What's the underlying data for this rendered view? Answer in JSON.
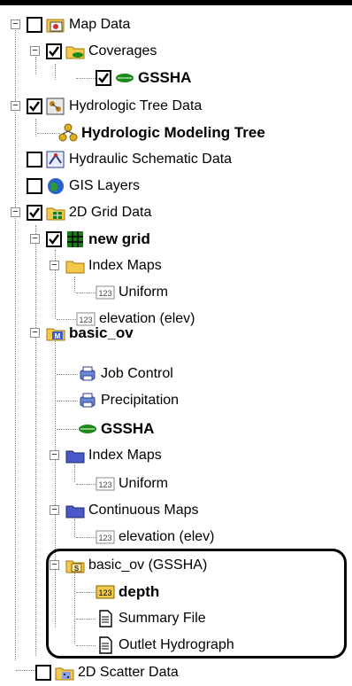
{
  "tree": {
    "map_data": "Map Data",
    "coverages": "Coverages",
    "gssha_cov": "GSSHA",
    "hydrologic_tree_data": "Hydrologic Tree Data",
    "hydrologic_modeling_tree": "Hydrologic Modeling Tree",
    "hydraulic_schematic_data": "Hydraulic Schematic Data",
    "gis_layers": "GIS Layers",
    "grid_data_2d": "2D Grid Data",
    "new_grid": "new grid",
    "index_maps_1": "Index Maps",
    "uniform_1": "Uniform",
    "elevation_1": "elevation (elev)",
    "basic_ov": "basic_ov",
    "job_control": "Job Control",
    "precipitation": "Precipitation",
    "gssha_model": "GSSHA",
    "index_maps_2": "Index Maps",
    "uniform_2": "Uniform",
    "continuous_maps": "Continuous Maps",
    "elevation_2": "elevation (elev)",
    "basic_ov_gssha": "basic_ov (GSSHA)",
    "depth": "depth",
    "summary_file": "Summary File",
    "outlet_hydrograph": "Outlet Hydrograph",
    "scatter_data_2d": "2D Scatter Data"
  },
  "icons": {
    "badge_123": "123",
    "badge_s": "S",
    "badge_m": "M"
  },
  "colors": {
    "folder_yellow": "#f4c84a",
    "grid_green": "#1a7a1a",
    "model_blue": "#3c5fd0",
    "gis_blue": "#2a62c9"
  }
}
